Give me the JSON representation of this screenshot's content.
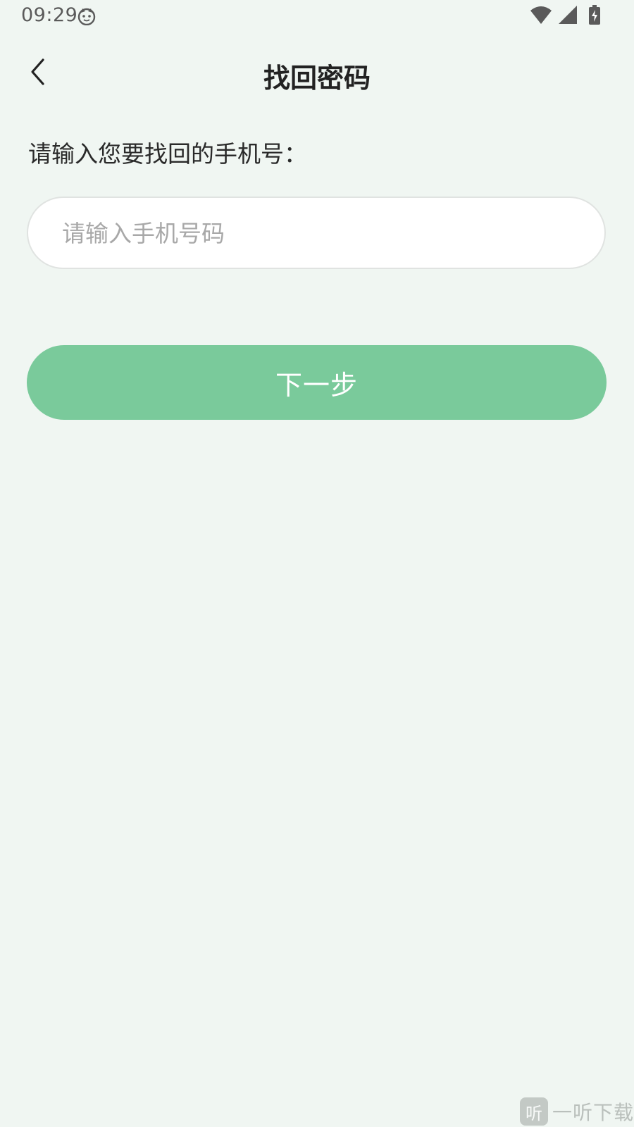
{
  "status_bar": {
    "time": "09:29",
    "app_icon": "cat-face-icon",
    "right_icons": [
      "wifi-icon",
      "cellular-signal-icon",
      "battery-charging-icon"
    ]
  },
  "header": {
    "back_icon": "chevron-left-icon",
    "title": "找回密码"
  },
  "form": {
    "prompt": "请输入您要找回的手机号：",
    "phone_input": {
      "value": "",
      "placeholder": "请输入手机号码"
    },
    "next_label": "下一步"
  },
  "colors": {
    "background": "#f0f6f2",
    "primary_button": "#7aca9b",
    "title_text": "#222222",
    "placeholder": "#a8a8a8"
  },
  "watermark": {
    "logo_char": "听",
    "text": "一听下载"
  }
}
